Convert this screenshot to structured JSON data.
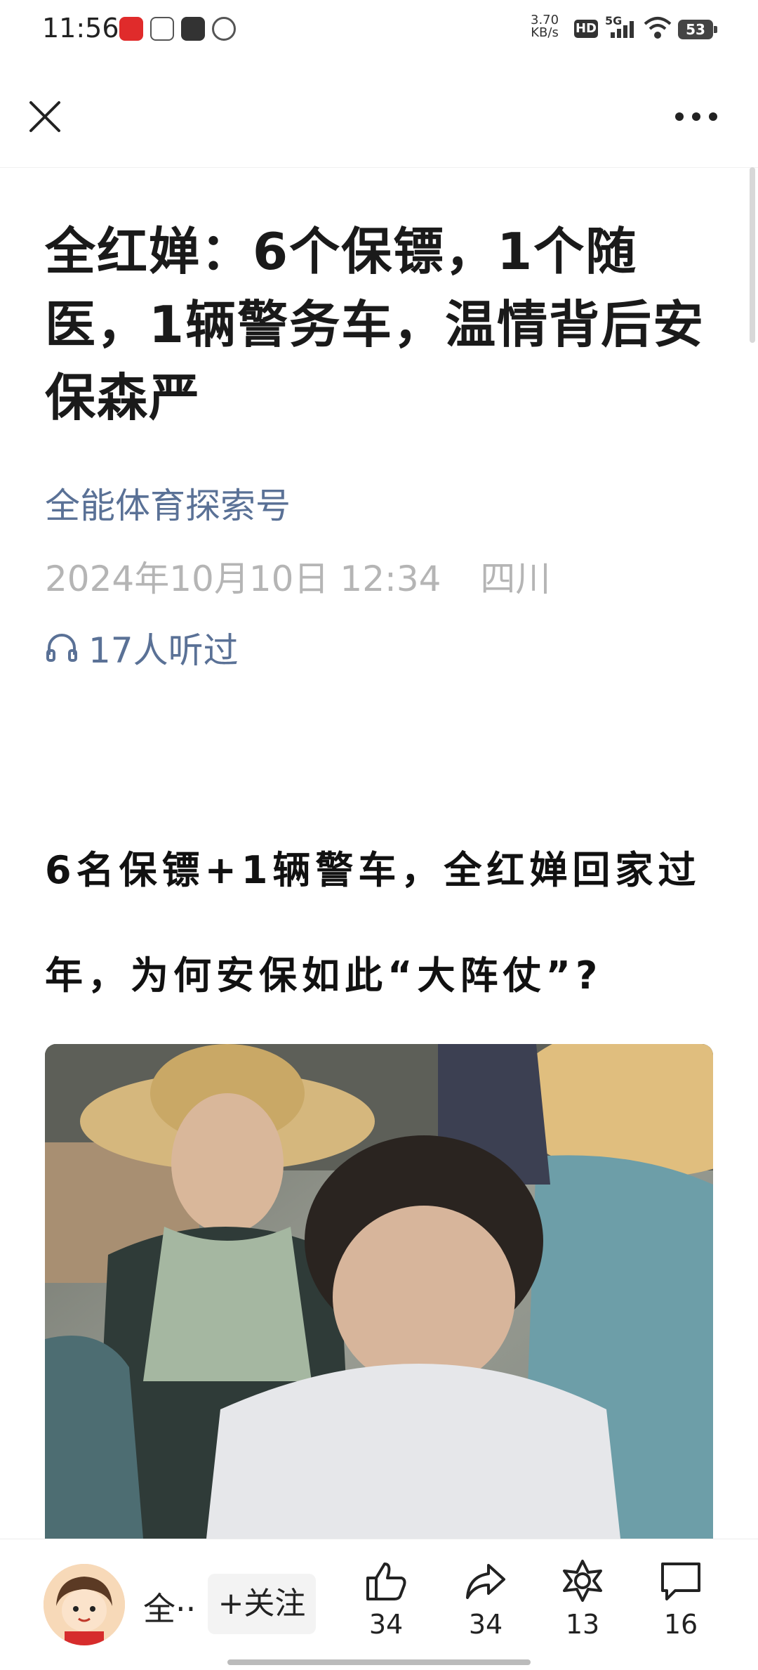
{
  "status_bar": {
    "time": "11:56",
    "network_speed_value": "3.70",
    "network_speed_unit": "KB/s",
    "hd_label": "HD",
    "signal_label": "5G",
    "battery": "53",
    "notification_icons": [
      "app-icon-red",
      "toutiao-icon",
      "message-icon",
      "leaf-icon"
    ]
  },
  "nav": {
    "close_icon": "close-icon",
    "more_icon": "more-icon"
  },
  "article": {
    "title": "全红婵：6个保镖，1个随医，1辆警务车，温情背后安保森严",
    "author": "全能体育探索号",
    "date": "2024年10月10日 12:34",
    "location": "四川",
    "listen_text": "17人听过",
    "subheading_line1": "6名保镖+1辆警车，全红婵回家过",
    "subheading_line2": "年，为何安保如此“大阵仗”?"
  },
  "bottom_bar": {
    "account_name": "全··",
    "follow_label": "+关注",
    "like_count": "34",
    "share_count": "34",
    "favorite_count": "13",
    "comment_count": "16"
  }
}
